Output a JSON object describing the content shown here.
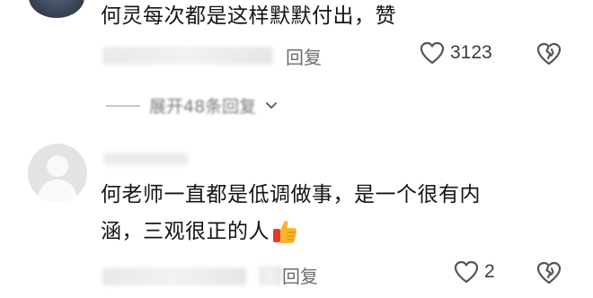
{
  "comments": [
    {
      "text": "何灵每次都是这样默默付出，赞",
      "reply_label": "回复",
      "likes": "3123",
      "expand_replies": "展开48条回复"
    },
    {
      "text_line1": "何老师一直都是低调做事，是一个很有内",
      "text_line2": "涵，三观很正的人",
      "reply_label": "回复",
      "likes": "2"
    }
  ],
  "icons": {
    "like": "heart-outline-icon",
    "dislike": "broken-heart-icon",
    "expand": "chevron-down-icon",
    "thumb": "thumbs-up-emoji"
  },
  "colors": {
    "text": "#141414",
    "meta": "#6d6d6d",
    "icon": "#555555",
    "divider": "#c9c9c9"
  }
}
